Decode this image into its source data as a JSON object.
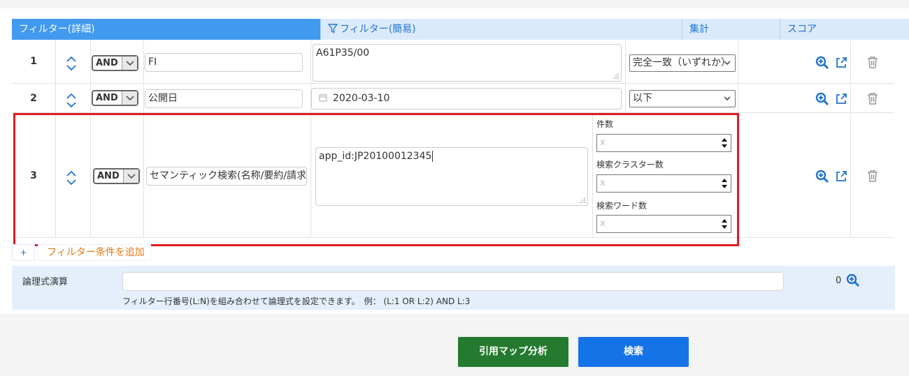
{
  "tabs": {
    "detail": "フィルター(詳細)",
    "simple": "フィルター(簡易)",
    "stats": "集計",
    "score": "スコア"
  },
  "rows": [
    {
      "num": "1",
      "op": "AND",
      "field": "FI",
      "value": "A61P35/00",
      "match": "完全一致（いずれか）"
    },
    {
      "num": "2",
      "op": "AND",
      "field": "公開日",
      "value": "2020-03-10",
      "match": "以下"
    },
    {
      "num": "3",
      "op": "AND",
      "field": "セマンティック検索(名称/要約/請求項)",
      "value": "app_id:JP20100012345",
      "params": [
        {
          "label": "件数",
          "placeholder": "x"
        },
        {
          "label": "検索クラスター数",
          "placeholder": "x"
        },
        {
          "label": "検索ワード数",
          "placeholder": "x"
        }
      ]
    }
  ],
  "add": {
    "plus": "+",
    "label": "フィルター条件を追加"
  },
  "logic": {
    "label": "論理式演算",
    "count": "0",
    "hint": "フィルター行番号(L:N)を組み合わせて論理式を設定できます。　例： (L:1 OR L:2) AND L:3"
  },
  "buttons": {
    "map": "引用マップ分析",
    "search": "検索"
  },
  "colors": {
    "accent": "#4199f0",
    "tab_bg": "#dbeafb",
    "highlight": "#e01b22",
    "map_btn": "#247a2e",
    "search_btn": "#1473e6",
    "add_text": "#e07a14"
  }
}
